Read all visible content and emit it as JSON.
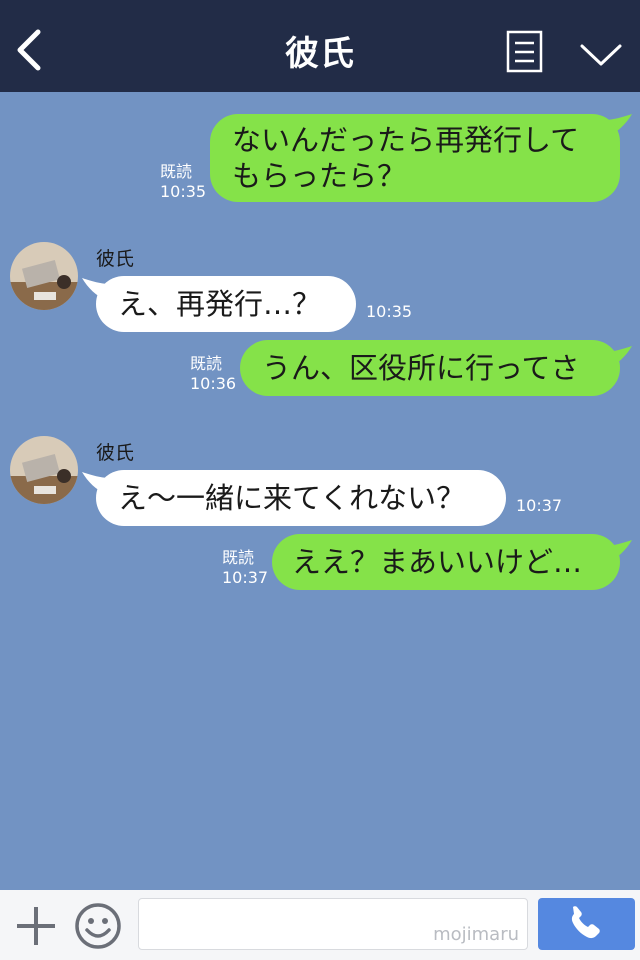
{
  "header": {
    "title": "彼氏",
    "back_icon": "chevron-left-icon",
    "notes_icon": "notes-icon",
    "menu_icon": "chevron-down-icon"
  },
  "messages": [
    {
      "side": "right",
      "lines": [
        "ないんだったら再発行して",
        "もらったら？"
      ],
      "read_label": "既読",
      "time": "10:35"
    },
    {
      "side": "left",
      "sender": "彼氏",
      "text": "え、再発行…？",
      "time": "10:35"
    },
    {
      "side": "right",
      "lines": [
        "うん、区役所に行ってさ"
      ],
      "read_label": "既読",
      "time": "10:36"
    },
    {
      "side": "left",
      "sender": "彼氏",
      "text": "え〜一緒に来てくれない？",
      "time": "10:37"
    },
    {
      "side": "right",
      "lines": [
        "ええ？まあいいけど…"
      ],
      "read_label": "既読",
      "time": "10:37"
    }
  ],
  "footer": {
    "watermark": "mojimaru",
    "plus_icon": "plus-icon",
    "emoji_icon": "emoji-icon",
    "call_icon": "phone-icon"
  },
  "colors": {
    "header_bg": "#222c47",
    "chat_bg": "#7293c3",
    "my_bubble": "#85e249",
    "their_bubble": "#ffffff",
    "call_button": "#5588e0"
  }
}
